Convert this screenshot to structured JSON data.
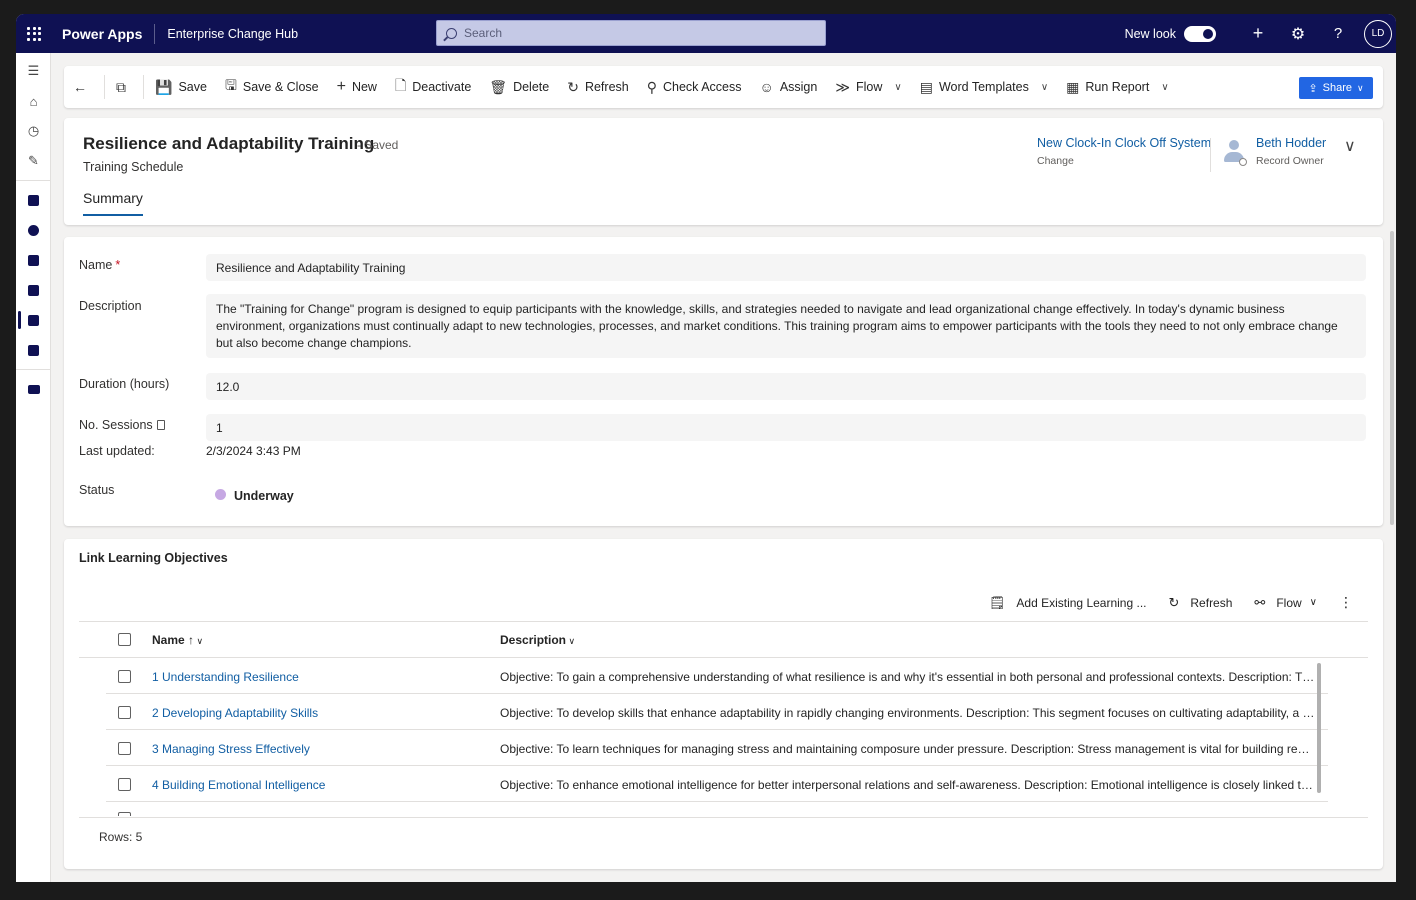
{
  "topbar": {
    "app_name": "Power Apps",
    "environment": "Enterprise Change Hub",
    "search_placeholder": "Search",
    "new_look_label": "New look",
    "user_initials": "LD"
  },
  "commands": [
    {
      "label": "Save",
      "icon": "save-icon"
    },
    {
      "label": "Save & Close",
      "icon": "save-close-icon"
    },
    {
      "label": "New",
      "icon": "plus-icon"
    },
    {
      "label": "Deactivate",
      "icon": "document-icon"
    },
    {
      "label": "Delete",
      "icon": "trash-icon"
    },
    {
      "label": "Refresh",
      "icon": "refresh-icon"
    },
    {
      "label": "Check Access",
      "icon": "key-icon"
    },
    {
      "label": "Assign",
      "icon": "person-icon"
    },
    {
      "label": "Flow",
      "icon": "flow-icon"
    },
    {
      "label": "Word Templates",
      "icon": "word-icon"
    },
    {
      "label": "Run Report",
      "icon": "report-icon"
    }
  ],
  "share_label": "Share",
  "record": {
    "title": "Resilience and Adaptability Training",
    "saved_status": "- Saved",
    "entity": "Training Schedule",
    "related_change": "New Clock-In Clock Off System",
    "related_change_label": "Change",
    "owner": "Beth Hodder",
    "owner_label": "Record Owner",
    "tab": "Summary"
  },
  "form": {
    "name_label": "Name",
    "required_mark": "*",
    "name_value": "Resilience and Adaptability Training",
    "description_label": "Description",
    "description_value": "The \"Training for Change\" program is designed to equip participants with the knowledge, skills, and strategies needed to navigate and lead organizational change effectively. In today's dynamic business environment, organizations must continually adapt to new technologies, processes, and market conditions. This training program aims to empower participants with the tools they need to not only embrace change but also become change champions.",
    "duration_label": "Duration (hours)",
    "duration_value": "12.0",
    "sessions_label": "No. Sessions",
    "sessions_value": "1",
    "updated_label": "Last updated:",
    "updated_value": "2/3/2024 3:43 PM",
    "status_label": "Status",
    "status_value": "Underway",
    "status_color": "#c6a8e3"
  },
  "subgrid": {
    "title": "Link Learning Objectives",
    "add_existing": "Add Existing Learning ...",
    "refresh": "Refresh",
    "flow": "Flow",
    "col_name": "Name",
    "col_desc": "Description",
    "rows": [
      {
        "name": "1 Understanding Resilience",
        "desc": "Objective: To gain a comprehensive understanding of what resilience is and why it's essential in both personal and professional contexts. Description: This m..."
      },
      {
        "name": "2 Developing Adaptability Skills",
        "desc": "Objective: To develop skills that enhance adaptability in rapidly changing environments. Description: This segment focuses on cultivating adaptability, a cruci..."
      },
      {
        "name": "3 Managing Stress Effectively",
        "desc": "Objective: To learn techniques for managing stress and maintaining composure under pressure. Description: Stress management is vital for building resilienc..."
      },
      {
        "name": "4 Building Emotional Intelligence",
        "desc": "Objective: To enhance emotional intelligence for better interpersonal relations and self-awareness. Description: Emotional intelligence is closely linked to resil..."
      }
    ],
    "rows_count": "Rows: 5"
  },
  "colors": {
    "topbar": "#0f1153",
    "link": "#115ea3",
    "share": "#2266e3"
  }
}
